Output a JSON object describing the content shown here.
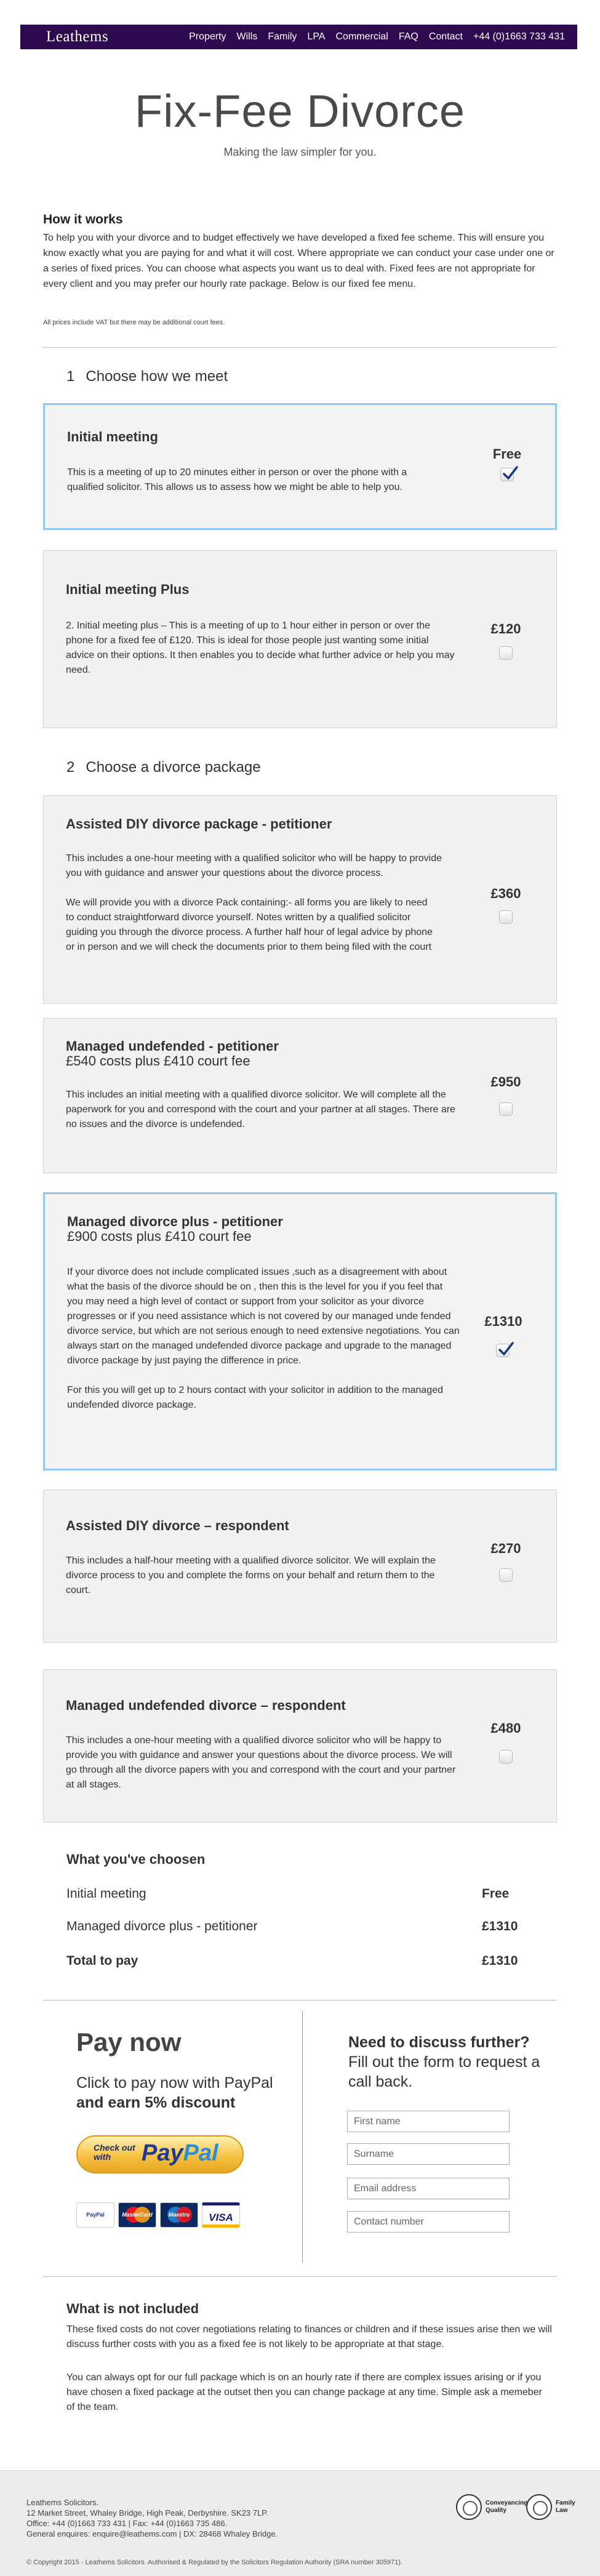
{
  "header": {
    "logo": "Leathems",
    "nav": [
      "Property",
      "Wills",
      "Family",
      "LPA",
      "Commercial",
      "FAQ",
      "Contact",
      "+44 (0)1663 733 431"
    ]
  },
  "hero": {
    "title": "Fix-Fee Divorce",
    "subtitle": "Making the law simpler for you."
  },
  "how": {
    "heading": "How it works",
    "body": "To help you with your divorce and to budget effectively we have developed a fixed fee scheme. This will ensure you know exactly what you are paying for and what it will cost. Where appropriate we can conduct your case under one or a series of fixed prices. You can choose what aspects you want us to deal with. Fixed fees are not appropriate for every client and you may prefer our hourly rate package. Below is our fixed fee menu.",
    "vat_note": "All prices include VAT but there may be additional court fees."
  },
  "section1": {
    "num": "1",
    "title": "Choose how we meet"
  },
  "section2": {
    "num": "2",
    "title": "Choose a divorce package"
  },
  "packages": [
    {
      "title": "Initial meeting",
      "subtitle": "",
      "body": [
        "This is a meeting of up to 20 minutes either in person or over the phone with a qualified solicitor. This allows us to assess how we might be able to help you."
      ],
      "price": "Free",
      "checked": true
    },
    {
      "title": "Initial meeting Plus",
      "subtitle": "",
      "body": [
        "2. Initial meeting plus – This is a meeting of  up to 1 hour either in person or over the phone for a fixed fee of £120. This is ideal for those people just wanting some initial advice on their options. It then enables you to decide what further advice or help you may need."
      ],
      "price": "£120",
      "checked": false
    },
    {
      "title": "Assisted DIY divorce package - petitioner",
      "subtitle": "",
      "body": [
        "This includes a one-hour meeting with a qualified solicitor who will be happy to provide you with guidance and answer your questions about the divorce process.",
        "We  will provide you with a divorce Pack containing:- all forms you are likely to need to conduct straightforward divorce yourself. Notes written by a qualified solicitor guiding you through the divorce process. A further half hour of legal advice by phone or in person and we will check the documents prior to them being filed with the court"
      ],
      "price": "£360",
      "checked": false
    },
    {
      "title": "Managed undefended - petitioner",
      "subtitle": "£540 costs plus £410 court fee",
      "body": [
        "This includes an initial meeting with a qualified divorce solicitor. We will complete all the paperwork for you and correspond with the court and your partner at all stages. There are no issues and the divorce is undefended."
      ],
      "price": "£950",
      "checked": false
    },
    {
      "title": "Managed divorce plus - petitioner",
      "subtitle": "£900 costs plus £410 court fee",
      "body": [
        "If your divorce  does not include complicated issues ,such as a disagreement with about what the basis of the divorce should be on , then this is the level for you if you feel that you may need a high level of contact or support from your solicitor as  your divorce progresses or if you need assistance which is not covered by our managed unde fended divorce service, but which are not serious enough to need extensive negotiations. You can always start on the managed undefended divorce package and upgrade to the managed divorce package by just paying the difference in price.",
        "For this you will get up to 2 hours contact with your solicitor in addition to the managed undefended divorce package."
      ],
      "price": "£1310",
      "checked": true
    },
    {
      "title": "Assisted DIY divorce – respondent",
      "subtitle": "",
      "body": [
        "This includes a half-hour meeting with a qualified divorce solicitor. We will explain the divorce process to you and complete the forms on your behalf and return them to the court."
      ],
      "price": "£270",
      "checked": false
    },
    {
      "title": "Managed undefended divorce – respondent",
      "subtitle": "",
      "body": [
        "This includes a one-hour meeting with a qualified divorce solicitor who will be happy to provide you with guidance and answer your questions about the divorce process. We will go through all the divorce papers with you and correspond with the court and your partner at all stages."
      ],
      "price": "£480",
      "checked": false
    }
  ],
  "summary": {
    "heading": "What you've choosen",
    "rows": [
      {
        "label": "Initial meeting",
        "value": "Free"
      },
      {
        "label": "Managed divorce plus - petitioner",
        "value": "£1310"
      }
    ],
    "total_label": "Total to pay",
    "total_value": "£1310"
  },
  "pay": {
    "heading": "Pay now",
    "text": "Click to pay now with PayPal",
    "discount": "and earn 5% discount",
    "button_small": "Check out with",
    "button_brand_a": "Pay",
    "button_brand_b": "Pal",
    "cards": [
      "PayPal",
      "MasterCard",
      "Maestro",
      "VISA"
    ]
  },
  "callback": {
    "heading": "Need to discuss further?",
    "text": "Fill out the form to request a call back.",
    "fields": [
      "First name",
      "Surname",
      "Email address",
      "Contact number"
    ]
  },
  "not_included": {
    "heading": "What is not included",
    "p1": "These fixed costs do not cover negotiations relating to finances or children and if these issues arise then we will discuss further costs with you as a fixed fee is not likely to be appropriate at that stage.",
    "p2": "You can always opt for our full package which is on an hourly rate if there are complex issues arising or if you have chosen a fixed package at the outset then you can change package at any time. Simple ask a memeber of the team."
  },
  "footer": {
    "address": [
      "Leathems Solicitors.",
      "12 Market Street, Whaley Bridge, High Peak, Derbyshire. SK23 7LP.",
      "Office: +44 (0)1663 733 431 | Fax: +44 (0)1663 735 486.",
      "General enquires: enquire@leathems.com | DX: 28468 Whaley Bridge."
    ],
    "copyright": "© Copyright 2015 - Leathems Solicitors. Authorised & Regulated by the Solicitors Regulation Authority (SRA number 305971).",
    "badges": [
      "Conveyancing Quality",
      "Family Law"
    ]
  }
}
